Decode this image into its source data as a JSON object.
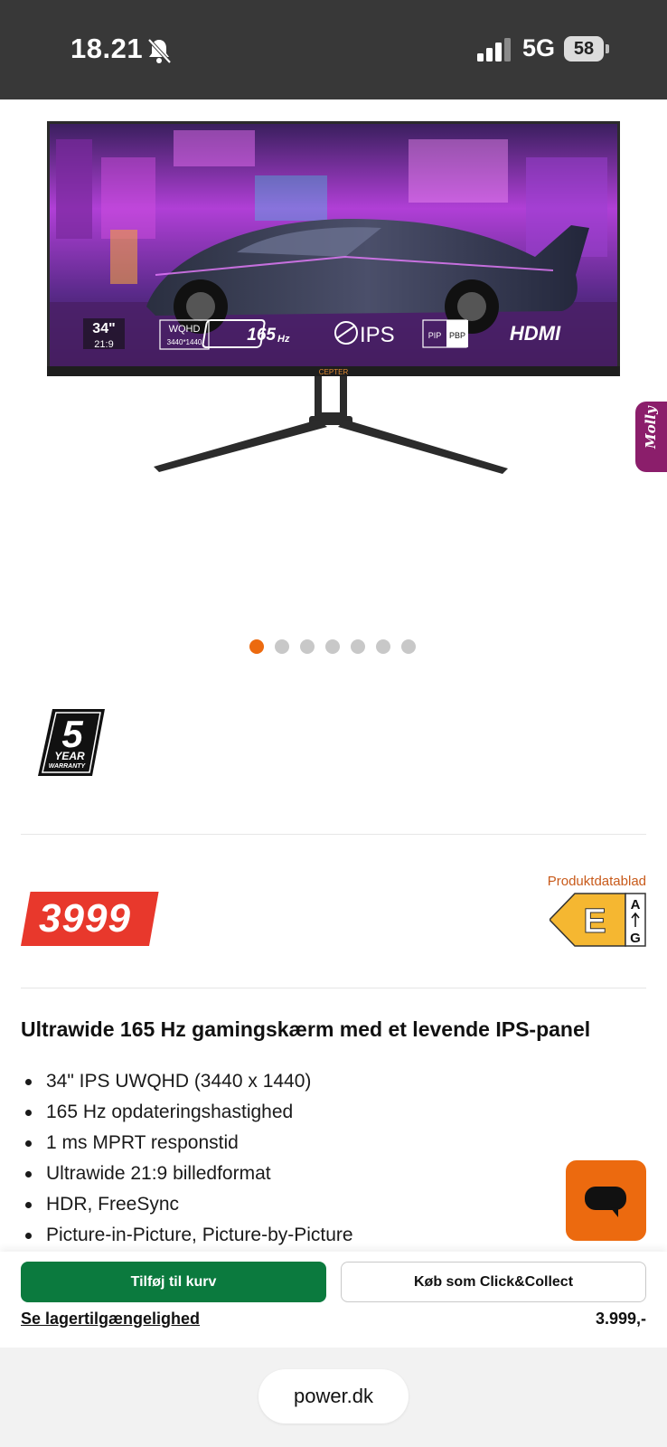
{
  "status_bar": {
    "time": "18.21",
    "network": "5G",
    "battery": "58"
  },
  "gallery": {
    "image_count": 7,
    "active_index": 0,
    "badges": {
      "size": "34\"",
      "ratio": "21:9",
      "resolution_name": "WQHD",
      "resolution": "3440*1440",
      "refresh": "165",
      "refresh_unit": "Hz",
      "panel": "IPS",
      "pip": "PIP",
      "pbp": "PBP",
      "hdmi": "HDMI",
      "brand": "CEPTER"
    }
  },
  "side_tab": {
    "label": "Molly"
  },
  "warranty": {
    "number": "5",
    "line1": "YEAR",
    "line2": "WARRANTY"
  },
  "price": {
    "value": "3999",
    "formatted": "3.999,-"
  },
  "energy_label": {
    "datasheet_link": "Produktdatablad",
    "class": "E",
    "scale_top": "A",
    "scale_bottom": "G",
    "color": "#f5b731"
  },
  "product": {
    "headline": "Ultrawide 165 Hz gamingskærm med et levende IPS-panel",
    "features": [
      "34\" IPS UWQHD (3440 x 1440)",
      "165 Hz opdateringshastighed",
      "1 ms MPRT responstid",
      "Ultrawide 21:9 billedformat",
      "HDR, FreeSync",
      "Picture-in-Picture, Picture-by-Picture"
    ]
  },
  "actions": {
    "add_to_cart": "Tilføj til kurv",
    "click_collect": "Køb som Click&Collect",
    "stock_link": "Se lagertilgængelighed"
  },
  "browser": {
    "url": "power.dk"
  },
  "colors": {
    "accent_orange": "#ec6a0f",
    "cart_green": "#0b7a3e",
    "price_red": "#e8382c",
    "status_bar": "#383838"
  }
}
